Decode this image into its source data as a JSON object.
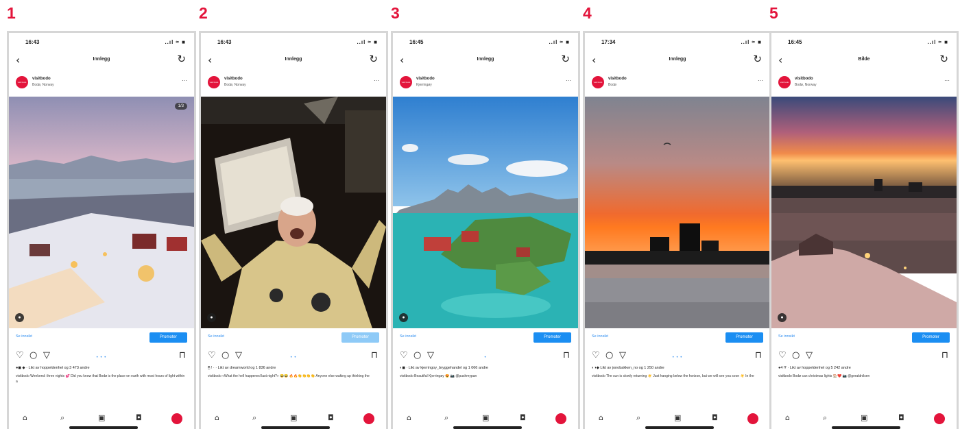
{
  "colors": {
    "accent": "#e3143b",
    "brand_blue": "#1b8ef2",
    "link_blue": "#2d8cf0"
  },
  "icons": {
    "back": "chevron-left-icon",
    "refresh": "refresh-icon",
    "more": "more-dots-icon",
    "like": "heart-icon",
    "comment": "comment-icon",
    "share": "send-icon",
    "save": "bookmark-icon",
    "home": "home-icon",
    "search": "search-icon",
    "reels": "reels-icon",
    "shop": "shop-icon",
    "tagged": "person-tag-icon"
  },
  "glyphs": {
    "back": "‹",
    "refresh": "↻",
    "more": "···",
    "like": "♡",
    "comment": "○",
    "share": "▽",
    "save": "⊓",
    "home": "⌂",
    "search": "⌕",
    "reels": "▣",
    "shop": "◘",
    "tagged": "●"
  },
  "panels": [
    {
      "number": "1",
      "time": "16:43",
      "signal": "..ıl ≈ ■",
      "nav_title": "Innlegg",
      "username": "visitbodo",
      "location": "Bodø, Norway",
      "avatar_text": "visit bodo",
      "badge": "1/3",
      "insights": "Se innsikt",
      "promote": "Promoter",
      "pager": "• • •",
      "likes": "●◼ ◆ · Likt av hoppeldenhel og 3 473 andre",
      "caption": "visitbodo Weekend: three nights 💕 Did you know that Bodø is the place on earth with most hours of light within a"
    },
    {
      "number": "2",
      "time": "16:43",
      "signal": "..ıl ≈ ■",
      "nav_title": "Innlegg",
      "username": "visitbodo",
      "location": "Bodø, Norway",
      "avatar_text": "visit bodo",
      "badge": "",
      "insights": "Se innsikt",
      "promote": "Promoter",
      "pager": "• •",
      "likes": "🖱 ! · · Likt av dreamworld og 1 836 andre",
      "caption": "visitbodo «What the hell happened last night?» 😂😂 🔥🔥👏👏👏👏 Anyone else waking up thinking the"
    },
    {
      "number": "3",
      "time": "16:45",
      "signal": "..ıl ≈ ■",
      "nav_title": "Innlegg",
      "username": "visitbodo",
      "location": "Kjerringøy",
      "avatar_text": "visit bodo",
      "badge": "",
      "insights": "Se innsikt",
      "promote": "Promoter",
      "pager": "•",
      "likes": "◐◼ · Likt av kjerringoy_bryggehandel og 1 066 andre",
      "caption": "visitbodo Beautiful Kjerringøy 😍 📷 @pushmypan"
    },
    {
      "number": "4",
      "time": "17:34",
      "signal": "..ıl ≈ ■",
      "nav_title": "Innlegg",
      "username": "visitbodo",
      "location": "Bodø",
      "avatar_text": "visit bodo",
      "badge": "",
      "insights": "Se innsikt",
      "promote": "Promoter",
      "pager": "• • •",
      "likes": "◐◑◆ Likt av jonobakken_no og 1 250 andre",
      "caption": "visitbodo The sun is slowly returning ☀️ Just hanging below the horizon, but we will see you soon ☀️ In the"
    },
    {
      "number": "5",
      "time": "16:45",
      "signal": "..ıl ≈ ■",
      "nav_title": "Bilde",
      "username": "visitbodo",
      "location": "Bodø, Norway",
      "avatar_text": "visit bodo",
      "badge": "",
      "insights": "Se innsikt",
      "promote": "Promoter",
      "pager": "",
      "likes": "●4 ⁉ · Likt av hoppeldenhel og 5 242 andre",
      "caption": "visitbodo Bodø can christmas lights 🏠❤️ 📷 @geraldnilsen"
    }
  ]
}
